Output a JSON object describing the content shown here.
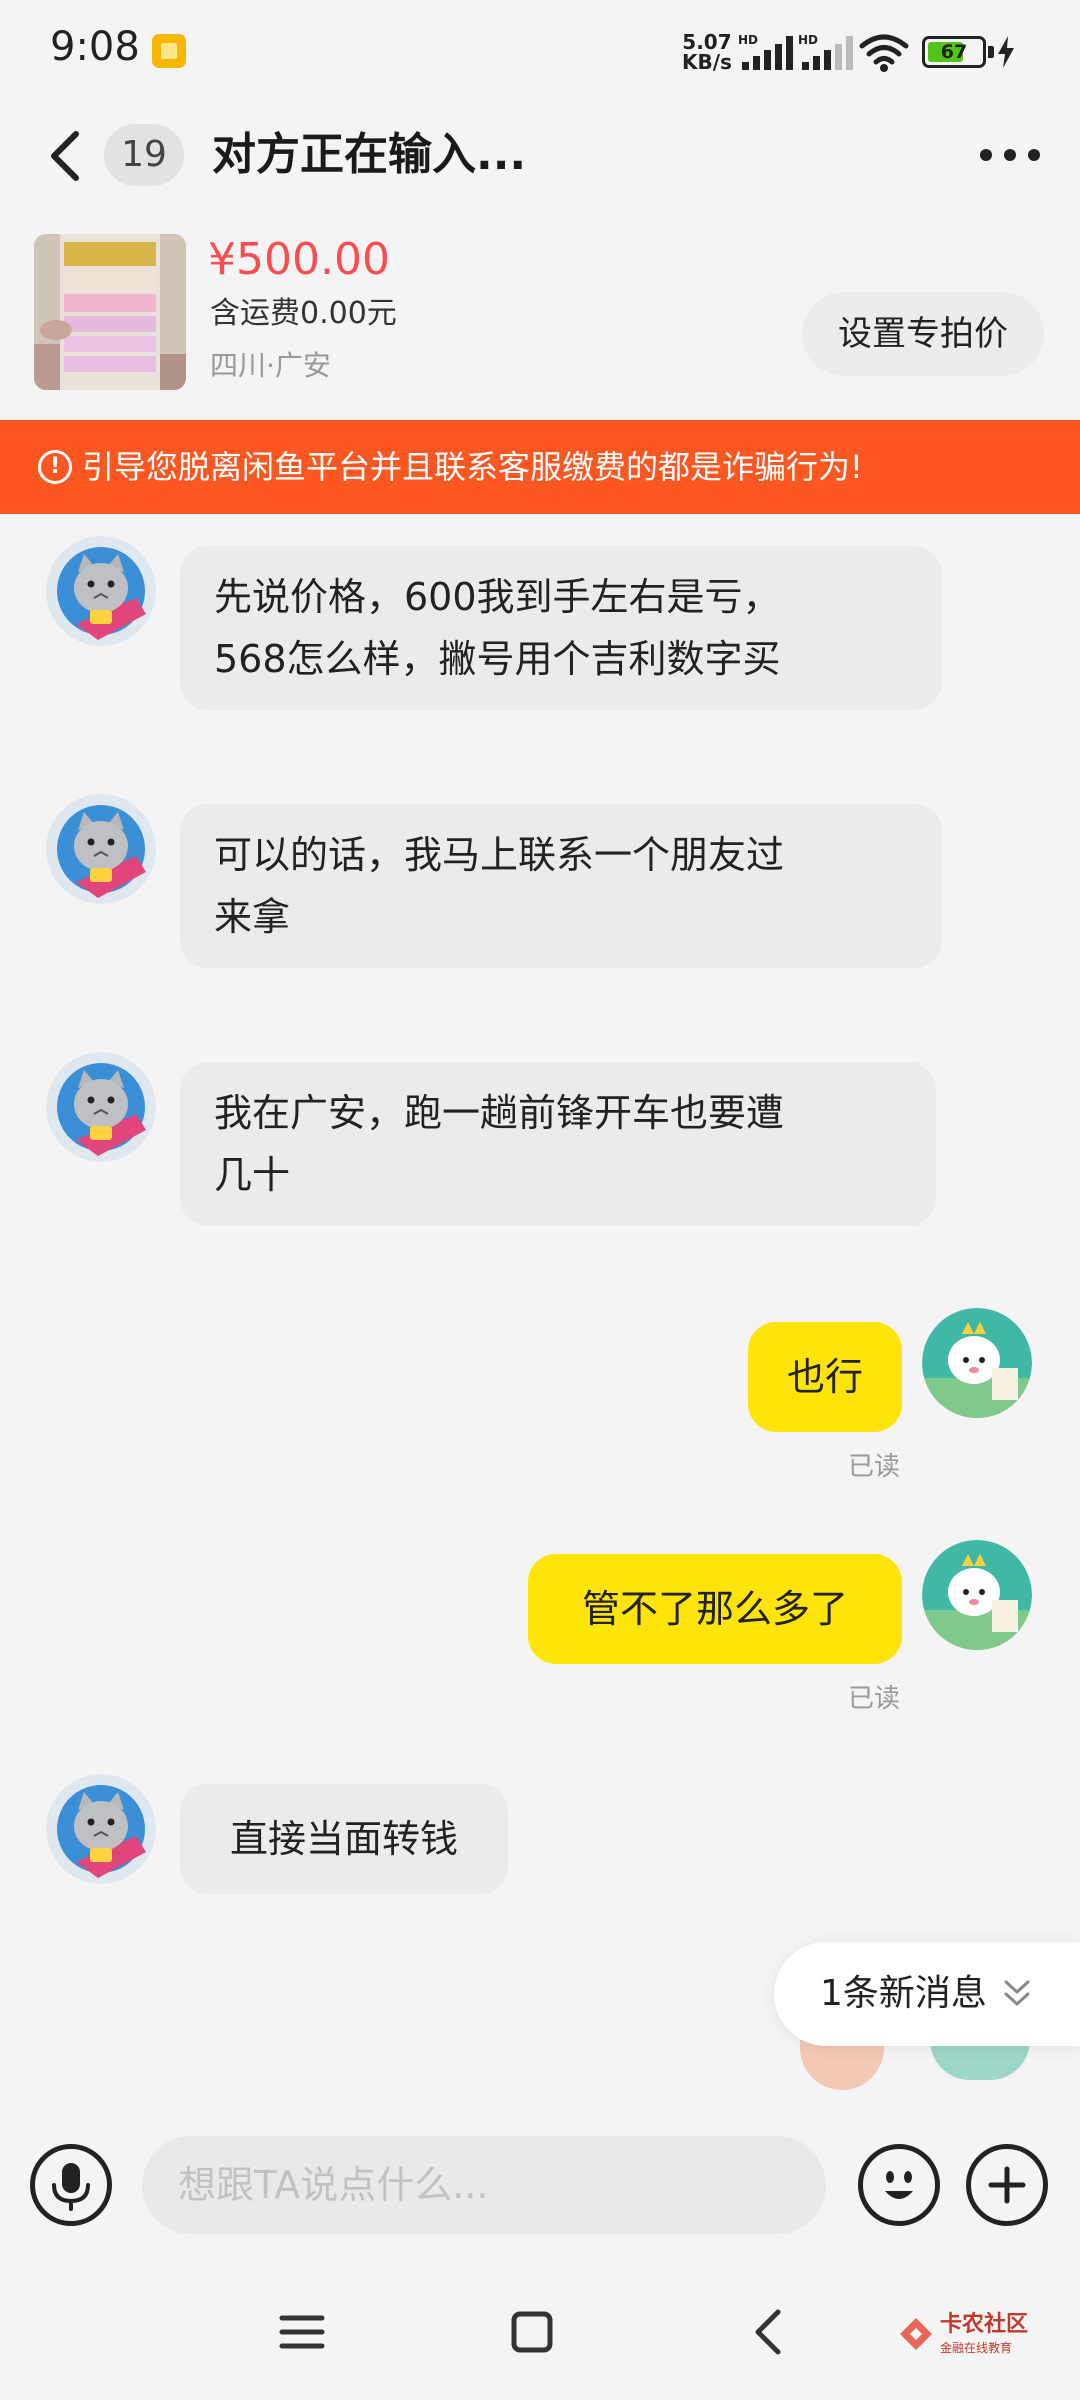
{
  "status_bar": {
    "time": "9:08",
    "net_speed_value": "5.07",
    "net_speed_unit": "KB/s",
    "signal_label_1": "HD",
    "signal_label_2": "HD",
    "battery_level": "67",
    "battery_fraction": 0.67
  },
  "header": {
    "unread_count": "19",
    "title": "对方正在输入..."
  },
  "product": {
    "price": "¥500.00",
    "shipping": "含运费0.00元",
    "location": "四川·广安",
    "set_price_label": "设置专拍价"
  },
  "warning": {
    "icon_text": "!",
    "text": "引导您脱离闲鱼平台并且联系客服缴费的都是诈骗行为!"
  },
  "messages": [
    {
      "from": "other",
      "lines": [
        "先说价格，600我到手左右是亏，",
        "568怎么样，撇号用个吉利数字买"
      ]
    },
    {
      "from": "other",
      "lines": [
        "可以的话，我马上联系一个朋友过",
        "来拿"
      ]
    },
    {
      "from": "other",
      "lines": [
        "我在广安，跑一趟前锋开车也要遭",
        "几十"
      ]
    },
    {
      "from": "me",
      "text": "也行",
      "status": "已读"
    },
    {
      "from": "me",
      "text": "管不了那么多了",
      "status": "已读"
    },
    {
      "from": "other",
      "text": "直接当面转钱"
    }
  ],
  "new_message_pill": {
    "label": "1条新消息"
  },
  "input": {
    "placeholder": "想跟TA说点什么..."
  },
  "watermark": {
    "title": "卡农社区",
    "subtitle": "金融在线教育"
  },
  "colors": {
    "accent_yellow": "#ffe40a",
    "price_red": "#ff4d4f",
    "warning_orange": "#ff5722",
    "battery_green": "#52c41a"
  }
}
